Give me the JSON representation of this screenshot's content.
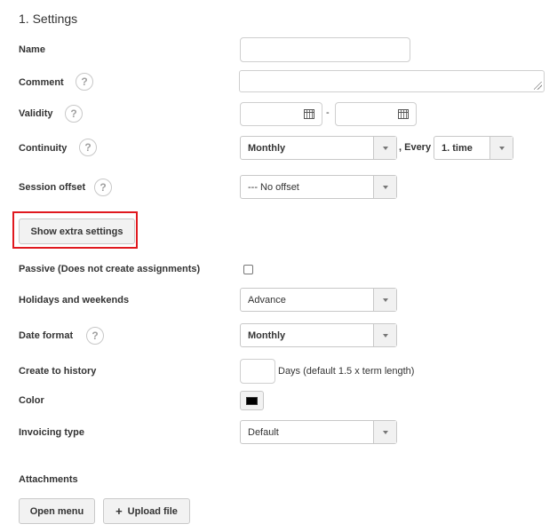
{
  "section": {
    "title": "1. Settings"
  },
  "fields": {
    "name": {
      "label": "Name",
      "value": ""
    },
    "comment": {
      "label": "Comment",
      "help": "?",
      "value": ""
    },
    "validity": {
      "label": "Validity",
      "help": "?",
      "start": "",
      "end": "",
      "separator": "-"
    },
    "continuity": {
      "label": "Continuity",
      "help": "?",
      "selected": "Monthly",
      "every_label": ", Every",
      "every_selected": "1. time"
    },
    "session_offset": {
      "label": "Session offset",
      "help": "?",
      "selected": "--- No offset"
    },
    "extra_settings_button": "Show extra settings",
    "passive": {
      "label": "Passive (Does not create assignments)",
      "checked": false
    },
    "holidays": {
      "label": "Holidays and weekends",
      "selected": "Advance"
    },
    "date_format": {
      "label": "Date format",
      "help": "?",
      "selected": "Monthly"
    },
    "create_history": {
      "label": "Create to history",
      "value": "",
      "suffix": "Days (default 1.5 x term length)"
    },
    "color": {
      "label": "Color",
      "value": "#000000"
    },
    "invoicing_type": {
      "label": "Invoicing type",
      "selected": "Default"
    }
  },
  "attachments": {
    "label": "Attachments",
    "open_menu": "Open menu",
    "upload_file": "Upload file",
    "upload_icon": "plus-icon"
  },
  "colors": {
    "highlight": "#e0191f"
  }
}
